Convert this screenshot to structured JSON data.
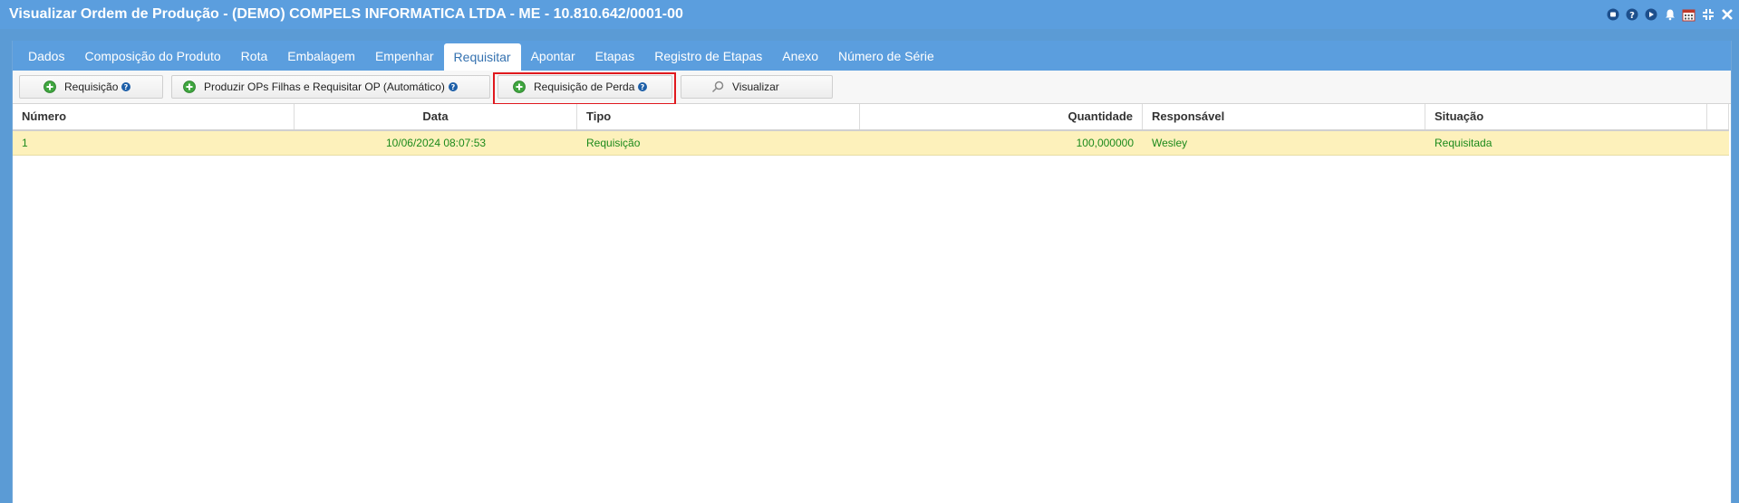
{
  "window": {
    "title": "Visualizar Ordem de Produção - (DEMO) COMPELS INFORMATICA LTDA - ME - 10.810.642/0001-00"
  },
  "title_icons": [
    "record-icon",
    "help-icon",
    "play-icon",
    "bell-icon",
    "calendar-icon",
    "collapse-icon",
    "close-icon"
  ],
  "tabs": [
    {
      "label": "Dados"
    },
    {
      "label": "Composição do Produto"
    },
    {
      "label": "Rota"
    },
    {
      "label": "Embalagem"
    },
    {
      "label": "Empenhar"
    },
    {
      "label": "Requisitar",
      "active": true
    },
    {
      "label": "Apontar"
    },
    {
      "label": "Etapas"
    },
    {
      "label": "Registro de Etapas"
    },
    {
      "label": "Anexo"
    },
    {
      "label": "Número de Série"
    }
  ],
  "toolbar": {
    "requisicao": "Requisição",
    "produzir": "Produzir OPs Filhas e Requisitar OP (Automático)",
    "requisicao_perda": "Requisição de Perda",
    "visualizar": "Visualizar"
  },
  "grid": {
    "columns": [
      "Número",
      "Data",
      "Tipo",
      "Quantidade",
      "Responsável",
      "Situação"
    ],
    "rows": [
      {
        "numero": "1",
        "data": "10/06/2024 08:07:53",
        "tipo": "Requisição",
        "quantidade": "100,000000",
        "responsavel": "Wesley",
        "situacao": "Requisitada"
      }
    ]
  },
  "colors": {
    "title_bar": "#5b9ede",
    "row_highlight": "#fdf1bb",
    "row_text": "#1b8a1b",
    "focus_box": "#e0191e"
  }
}
